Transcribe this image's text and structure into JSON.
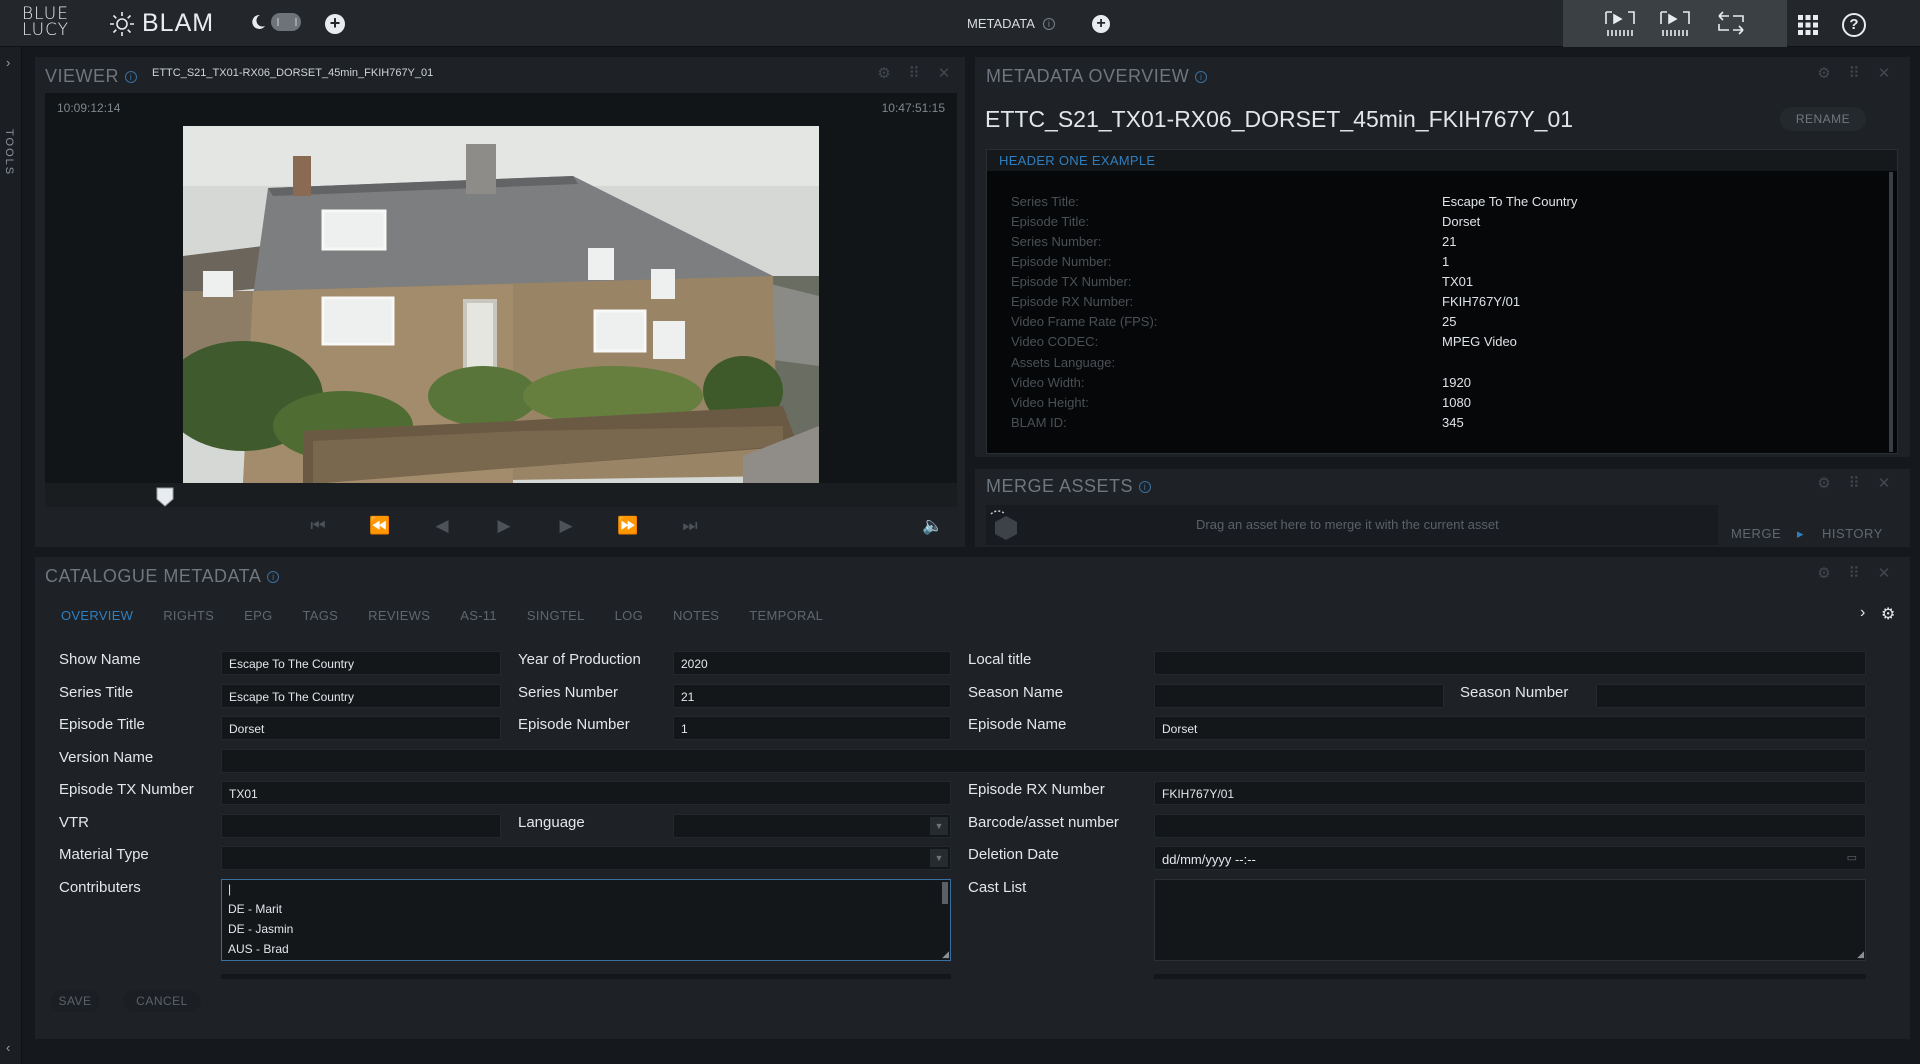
{
  "topbar": {
    "logo_line1": "BLUE",
    "logo_line2": "LUCY",
    "app_name": "BLAM",
    "center_label": "METADATA",
    "center_info": "i",
    "help": "?"
  },
  "sidebar": {
    "tools_label": "TOOLS"
  },
  "viewer": {
    "title": "VIEWER",
    "filename": "ETTC_S21_TX01-RX06_DORSET_45min_FKIH767Y_01",
    "timecode_start": "10:09:12:14",
    "timecode_end": "10:47:51:15"
  },
  "metadata_overview": {
    "title": "METADATA OVERVIEW",
    "asset_name": "ETTC_S21_TX01-RX06_DORSET_45min_FKIH767Y_01",
    "rename_label": "RENAME",
    "header": "HEADER ONE EXAMPLE",
    "rows": [
      {
        "key": "Series Title:",
        "value": "Escape To The Country"
      },
      {
        "key": "Episode Title:",
        "value": "Dorset"
      },
      {
        "key": "Series Number:",
        "value": "21"
      },
      {
        "key": "Episode Number:",
        "value": "1"
      },
      {
        "key": "Episode TX Number:",
        "value": "TX01"
      },
      {
        "key": "Episode RX Number:",
        "value": "FKIH767Y/01"
      },
      {
        "key": "Video Frame Rate (FPS):",
        "value": "25"
      },
      {
        "key": "Video CODEC:",
        "value": "MPEG Video"
      },
      {
        "key": "Assets Language:",
        "value": ""
      },
      {
        "key": "Video Width:",
        "value": "1920"
      },
      {
        "key": "Video Height:",
        "value": "1080"
      },
      {
        "key": "BLAM ID:",
        "value": "345"
      }
    ]
  },
  "merge_assets": {
    "title": "MERGE ASSETS",
    "hint": "Drag an asset here to merge it with the current asset",
    "merge_label": "MERGE",
    "history_label": "HISTORY"
  },
  "catalogue": {
    "title": "CATALOGUE METADATA",
    "tabs": [
      "OVERVIEW",
      "RIGHTS",
      "EPG",
      "TAGS",
      "REVIEWS",
      "AS-11",
      "SINGTEL",
      "LOG",
      "NOTES",
      "TEMPORAL"
    ],
    "labels": {
      "show_name": "Show Name",
      "year": "Year of Production",
      "local_title": "Local title",
      "series_title": "Series Title",
      "series_number": "Series Number",
      "season_name": "Season Name",
      "season_number": "Season Number",
      "episode_title": "Episode Title",
      "episode_number": "Episode Number",
      "episode_name": "Episode Name",
      "version_name": "Version Name",
      "tx_number": "Episode TX Number",
      "rx_number": "Episode RX Number",
      "vtr": "VTR",
      "language": "Language",
      "barcode": "Barcode/asset number",
      "material_type": "Material Type",
      "deletion_date": "Deletion Date",
      "contributers": "Contributers",
      "cast_list": "Cast List"
    },
    "values": {
      "show_name": "Escape To The Country",
      "year": "2020",
      "local_title": "",
      "series_title": "Escape To The Country",
      "series_number": "21",
      "season_name": "",
      "season_number": "",
      "episode_title": "Dorset",
      "episode_number": "1",
      "episode_name": "Dorset",
      "version_name": "",
      "tx_number": "TX01",
      "rx_number": "FKIH767Y/01",
      "vtr": "",
      "language": "",
      "barcode": "",
      "material_type": "",
      "deletion_date_placeholder": "dd/mm/yyyy --:--",
      "contributers": [
        "DE - Marit",
        "DE - Jasmin",
        "AUS - Brad"
      ],
      "cast_list": ""
    },
    "save_label": "SAVE",
    "cancel_label": "CANCEL"
  }
}
